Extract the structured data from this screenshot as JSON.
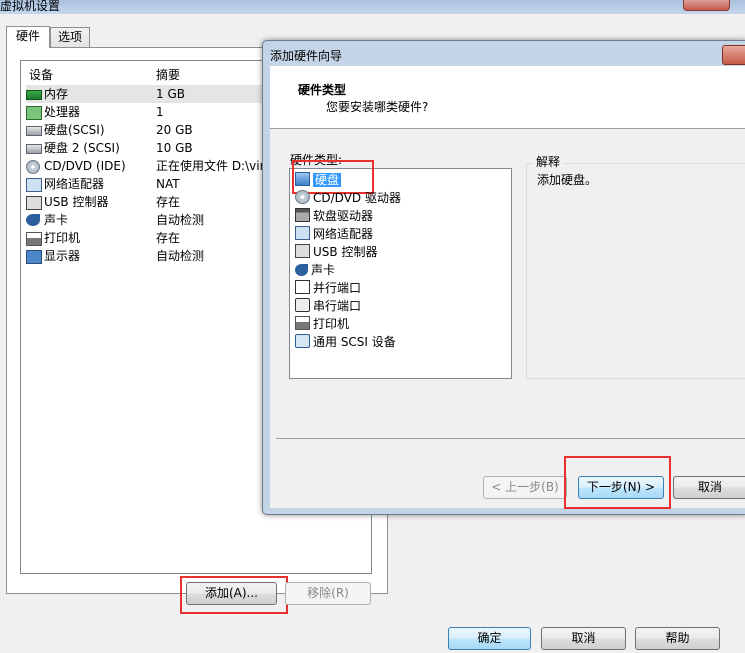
{
  "window": {
    "title": "虚拟机设置"
  },
  "tabs": [
    {
      "label": "硬件"
    },
    {
      "label": "选项"
    }
  ],
  "device_table": {
    "headers": {
      "device": "设备",
      "summary": "摘要"
    },
    "rows": [
      {
        "icon": "memory-icon",
        "name": "内存",
        "summary": "1 GB"
      },
      {
        "icon": "processor-icon",
        "name": "处理器",
        "summary": "1"
      },
      {
        "icon": "hard-disk-icon",
        "name": "硬盘(SCSI)",
        "summary": "20 GB"
      },
      {
        "icon": "hard-disk-icon",
        "name": "硬盘 2 (SCSI)",
        "summary": "10 GB"
      },
      {
        "icon": "cd-dvd-icon",
        "name": "CD/DVD (IDE)",
        "summary": "正在使用文件 D:\\vir"
      },
      {
        "icon": "network-adapter-icon",
        "name": "网络适配器",
        "summary": "NAT"
      },
      {
        "icon": "usb-icon",
        "name": "USB 控制器",
        "summary": "存在"
      },
      {
        "icon": "sound-card-icon",
        "name": "声卡",
        "summary": "自动检测"
      },
      {
        "icon": "printer-icon",
        "name": "打印机",
        "summary": "存在"
      },
      {
        "icon": "display-icon",
        "name": "显示器",
        "summary": "自动检测"
      }
    ]
  },
  "buttons": {
    "add": "添加(A)...",
    "remove": "移除(R)",
    "ok": "确定",
    "cancel": "取消",
    "help": "帮助"
  },
  "wizard": {
    "title": "添加硬件向导",
    "heading": "硬件类型",
    "subheading": "您要安装哪类硬件?",
    "hardware_type_label": "硬件类型:",
    "items": [
      {
        "icon": "hard-disk-icon",
        "label": "硬盘"
      },
      {
        "icon": "cd-dvd-icon",
        "label": "CD/DVD 驱动器"
      },
      {
        "icon": "floppy-icon",
        "label": "软盘驱动器"
      },
      {
        "icon": "network-adapter-icon",
        "label": "网络适配器"
      },
      {
        "icon": "usb-icon",
        "label": "USB 控制器"
      },
      {
        "icon": "sound-card-icon",
        "label": "声卡"
      },
      {
        "icon": "parallel-port-icon",
        "label": "并行端口"
      },
      {
        "icon": "serial-port-icon",
        "label": "串行端口"
      },
      {
        "icon": "printer-icon",
        "label": "打印机"
      },
      {
        "icon": "scsi-icon",
        "label": "通用 SCSI 设备"
      }
    ],
    "explanation_label": "解释",
    "explanation_text": "添加硬盘。",
    "buttons": {
      "back": "< 上一步(B)",
      "next": "下一步(N) >",
      "cancel": "取消"
    }
  }
}
